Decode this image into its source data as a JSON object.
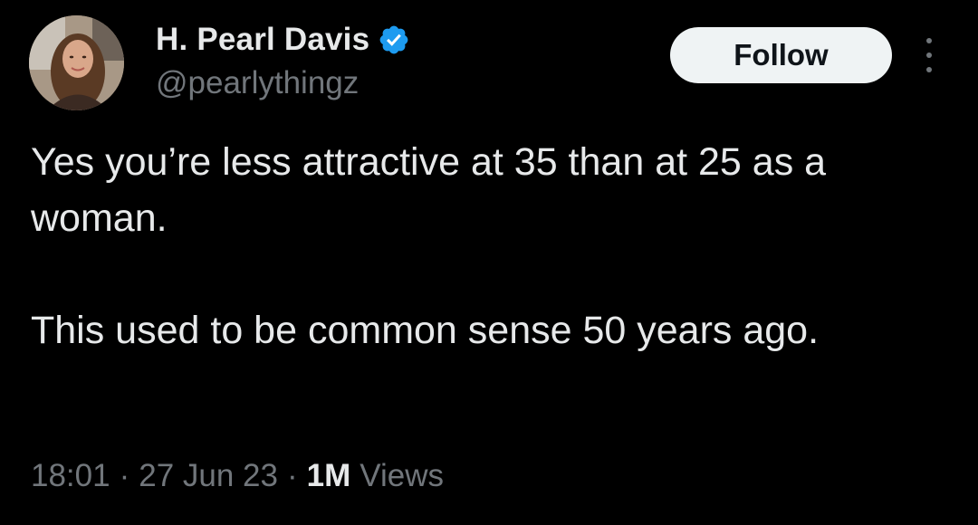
{
  "author": {
    "display_name": "H. Pearl Davis",
    "handle": "@pearlythingz",
    "verified": true,
    "avatar_icon": "profile-photo"
  },
  "actions": {
    "follow_label": "Follow",
    "more_icon": "vertical-ellipsis-icon"
  },
  "tweet": {
    "paragraphs": [
      "Yes you’re less attractive at 35 than at 25 as a woman.",
      "This used to be common sense 50 years ago."
    ]
  },
  "meta": {
    "time": "18:01",
    "separator": "·",
    "date": "27 Jun 23",
    "views_count": "1M",
    "views_label": "Views"
  },
  "colors": {
    "background": "#000000",
    "primary_text": "#e7e9ea",
    "secondary_text": "#71767b",
    "verified_badge": "#1d9bf0",
    "follow_button_bg": "#eff3f4",
    "follow_button_text": "#0f1419"
  }
}
